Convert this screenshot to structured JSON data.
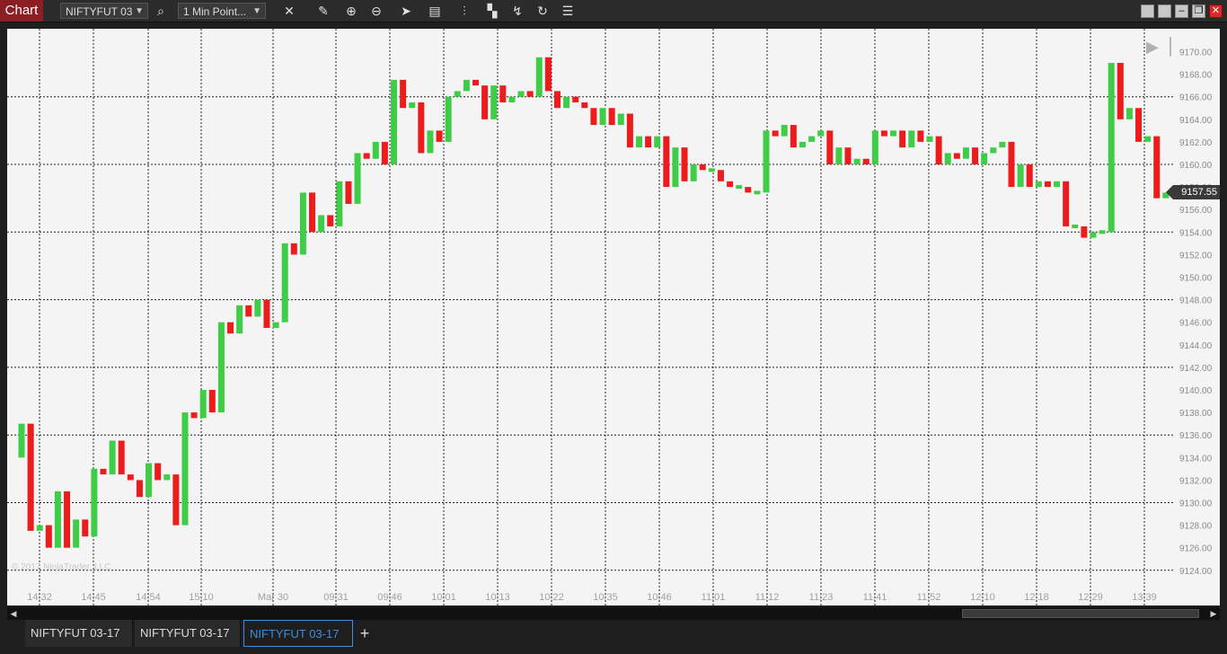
{
  "toolbar": {
    "chart_label": "Chart",
    "instrument_value": "NIFTYFUT 03",
    "interval_value": "1 Min Point...",
    "icons": [
      "bars-type-icon",
      "pencil-icon",
      "zoom-in-icon",
      "zoom-out-icon",
      "pointer-icon",
      "properties-icon",
      "layout-icon",
      "indicators-icon",
      "strategies-icon",
      "refresh-icon",
      "data-box-icon"
    ]
  },
  "window_buttons": [
    "restore-icon",
    "restore-icon",
    "minimize-icon",
    "maximize-icon",
    "close-icon"
  ],
  "watermark": "© 2017 NinjaTrader, LLC",
  "tabs": [
    "NIFTYFUT 03-17",
    "NIFTYFUT 03-17",
    "NIFTYFUT 03-17"
  ],
  "active_tab": 2,
  "current_price_label": "9157.55",
  "colors": {
    "up": "#3fcd48",
    "down": "#ed1c1c",
    "background": "#f4f4f4",
    "grid": "#222222",
    "chart_tab": "#8b1e24",
    "active_tab": "#3b8fe0"
  },
  "chart_data": {
    "type": "candlestick",
    "ylim": [
      9123,
      9171
    ],
    "y_ticks": [
      9124,
      9126,
      9128,
      9130,
      9132,
      9134,
      9136,
      9138,
      9140,
      9142,
      9144,
      9146,
      9148,
      9150,
      9152,
      9154,
      9156,
      9158,
      9160,
      9162,
      9164,
      9166,
      9168,
      9170
    ],
    "x_tick_labels": [
      "14:32",
      "14:45",
      "14:54",
      "15:10",
      "Mar 30",
      "09:31",
      "09:46",
      "10:01",
      "10:13",
      "10:22",
      "10:35",
      "10:46",
      "11:01",
      "11:12",
      "11:23",
      "11:41",
      "11:52",
      "12:10",
      "12:18",
      "12:29",
      "13:39"
    ],
    "dashed_horizontal_levels": [
      9124,
      9130,
      9136,
      9142,
      9148,
      9154,
      9160,
      9166
    ],
    "last_price": 9157.55,
    "bars": [
      {
        "o": 9134.0,
        "c": 9137.0
      },
      {
        "o": 9137.0,
        "c": 9127.5
      },
      {
        "o": 9127.5,
        "c": 9128.0
      },
      {
        "o": 9128.0,
        "c": 9126.0
      },
      {
        "o": 9126.0,
        "c": 9131.0
      },
      {
        "o": 9131.0,
        "c": 9126.0
      },
      {
        "o": 9126.0,
        "c": 9128.5
      },
      {
        "o": 9128.5,
        "c": 9127.0
      },
      {
        "o": 9127.0,
        "c": 9133.0
      },
      {
        "o": 9133.0,
        "c": 9132.5
      },
      {
        "o": 9132.5,
        "c": 9135.5
      },
      {
        "o": 9135.5,
        "c": 9132.5
      },
      {
        "o": 9132.5,
        "c": 9132.0
      },
      {
        "o": 9132.0,
        "c": 9130.5
      },
      {
        "o": 9130.5,
        "c": 9133.5
      },
      {
        "o": 9133.5,
        "c": 9132.0
      },
      {
        "o": 9132.0,
        "c": 9132.5
      },
      {
        "o": 9132.5,
        "c": 9128.0
      },
      {
        "o": 9128.0,
        "c": 9138.0
      },
      {
        "o": 9138.0,
        "c": 9137.5
      },
      {
        "o": 9137.5,
        "c": 9140.0
      },
      {
        "o": 9140.0,
        "c": 9138.0
      },
      {
        "o": 9138.0,
        "c": 9146.0
      },
      {
        "o": 9146.0,
        "c": 9145.0
      },
      {
        "o": 9145.0,
        "c": 9147.5
      },
      {
        "o": 9147.5,
        "c": 9146.5
      },
      {
        "o": 9146.5,
        "c": 9148.0
      },
      {
        "o": 9148.0,
        "c": 9145.5
      },
      {
        "o": 9145.5,
        "c": 9146.0
      },
      {
        "o": 9146.0,
        "c": 9153.0
      },
      {
        "o": 9153.0,
        "c": 9152.0
      },
      {
        "o": 9152.0,
        "c": 9157.5
      },
      {
        "o": 9157.5,
        "c": 9154.0
      },
      {
        "o": 9154.0,
        "c": 9155.5
      },
      {
        "o": 9155.5,
        "c": 9154.5
      },
      {
        "o": 9154.5,
        "c": 9158.5
      },
      {
        "o": 9158.5,
        "c": 9156.5
      },
      {
        "o": 9156.5,
        "c": 9161.0
      },
      {
        "o": 9161.0,
        "c": 9160.5
      },
      {
        "o": 9160.5,
        "c": 9162.0
      },
      {
        "o": 9162.0,
        "c": 9160.0
      },
      {
        "o": 9160.0,
        "c": 9167.5
      },
      {
        "o": 9167.5,
        "c": 9165.0
      },
      {
        "o": 9165.0,
        "c": 9165.5
      },
      {
        "o": 9165.5,
        "c": 9161.0
      },
      {
        "o": 9161.0,
        "c": 9163.0
      },
      {
        "o": 9163.0,
        "c": 9162.0
      },
      {
        "o": 9162.0,
        "c": 9166.0
      },
      {
        "o": 9166.0,
        "c": 9166.5
      },
      {
        "o": 9166.5,
        "c": 9167.5
      },
      {
        "o": 9167.5,
        "c": 9167.0
      },
      {
        "o": 9167.0,
        "c": 9164.0
      },
      {
        "o": 9164.0,
        "c": 9167.0
      },
      {
        "o": 9167.0,
        "c": 9165.5
      },
      {
        "o": 9165.5,
        "c": 9166.0
      },
      {
        "o": 9166.0,
        "c": 9166.5
      },
      {
        "o": 9166.5,
        "c": 9166.0
      },
      {
        "o": 9166.0,
        "c": 9169.5
      },
      {
        "o": 9169.5,
        "c": 9166.5
      },
      {
        "o": 9166.5,
        "c": 9165.0
      },
      {
        "o": 9165.0,
        "c": 9166.0
      },
      {
        "o": 9166.0,
        "c": 9165.5
      },
      {
        "o": 9165.5,
        "c": 9165.0
      },
      {
        "o": 9165.0,
        "c": 9163.5
      },
      {
        "o": 9163.5,
        "c": 9165.0
      },
      {
        "o": 9165.0,
        "c": 9163.5
      },
      {
        "o": 9163.5,
        "c": 9164.5
      },
      {
        "o": 9164.5,
        "c": 9161.5
      },
      {
        "o": 9161.5,
        "c": 9162.5
      },
      {
        "o": 9162.5,
        "c": 9161.5
      },
      {
        "o": 9161.5,
        "c": 9162.5
      },
      {
        "o": 9162.5,
        "c": 9158.0
      },
      {
        "o": 9158.0,
        "c": 9161.5
      },
      {
        "o": 9161.5,
        "c": 9158.5
      },
      {
        "o": 9158.5,
        "c": 9160.0
      },
      {
        "o": 9160.0,
        "c": 9159.5
      },
      {
        "o": 9159.5,
        "c": 9159.5
      },
      {
        "o": 9159.5,
        "c": 9158.5
      },
      {
        "o": 9158.5,
        "c": 9158.0
      },
      {
        "o": 9158.0,
        "c": 9158.0
      },
      {
        "o": 9158.0,
        "c": 9157.5
      },
      {
        "o": 9157.5,
        "c": 9157.5
      },
      {
        "o": 9157.5,
        "c": 9163.0
      },
      {
        "o": 9163.0,
        "c": 9162.5
      },
      {
        "o": 9162.5,
        "c": 9163.5
      },
      {
        "o": 9163.5,
        "c": 9161.5
      },
      {
        "o": 9161.5,
        "c": 9162.0
      },
      {
        "o": 9162.0,
        "c": 9162.5
      },
      {
        "o": 9162.5,
        "c": 9163.0
      },
      {
        "o": 9163.0,
        "c": 9160.0
      },
      {
        "o": 9160.0,
        "c": 9161.5
      },
      {
        "o": 9161.5,
        "c": 9160.0
      },
      {
        "o": 9160.0,
        "c": 9160.5
      },
      {
        "o": 9160.5,
        "c": 9160.0
      },
      {
        "o": 9160.0,
        "c": 9163.0
      },
      {
        "o": 9163.0,
        "c": 9162.5
      },
      {
        "o": 9162.5,
        "c": 9163.0
      },
      {
        "o": 9163.0,
        "c": 9161.5
      },
      {
        "o": 9161.5,
        "c": 9163.0
      },
      {
        "o": 9163.0,
        "c": 9162.0
      },
      {
        "o": 9162.0,
        "c": 9162.5
      },
      {
        "o": 9162.5,
        "c": 9160.0
      },
      {
        "o": 9160.0,
        "c": 9161.0
      },
      {
        "o": 9161.0,
        "c": 9160.5
      },
      {
        "o": 9160.5,
        "c": 9161.5
      },
      {
        "o": 9161.5,
        "c": 9160.0
      },
      {
        "o": 9160.0,
        "c": 9161.0
      },
      {
        "o": 9161.0,
        "c": 9161.5
      },
      {
        "o": 9161.5,
        "c": 9162.0
      },
      {
        "o": 9162.0,
        "c": 9158.0
      },
      {
        "o": 9158.0,
        "c": 9160.0
      },
      {
        "o": 9160.0,
        "c": 9158.0
      },
      {
        "o": 9158.0,
        "c": 9158.5
      },
      {
        "o": 9158.5,
        "c": 9158.0
      },
      {
        "o": 9158.0,
        "c": 9158.5
      },
      {
        "o": 9158.5,
        "c": 9154.5
      },
      {
        "o": 9154.5,
        "c": 9154.5
      },
      {
        "o": 9154.5,
        "c": 9153.5
      },
      {
        "o": 9153.5,
        "c": 9154.0
      },
      {
        "o": 9154.0,
        "c": 9154.0
      },
      {
        "o": 9154.0,
        "c": 9169.0
      },
      {
        "o": 9169.0,
        "c": 9164.0
      },
      {
        "o": 9164.0,
        "c": 9165.0
      },
      {
        "o": 9165.0,
        "c": 9162.0
      },
      {
        "o": 9162.0,
        "c": 9162.5
      },
      {
        "o": 9162.5,
        "c": 9157.0
      },
      {
        "o": 9157.0,
        "c": 9157.5
      }
    ]
  }
}
